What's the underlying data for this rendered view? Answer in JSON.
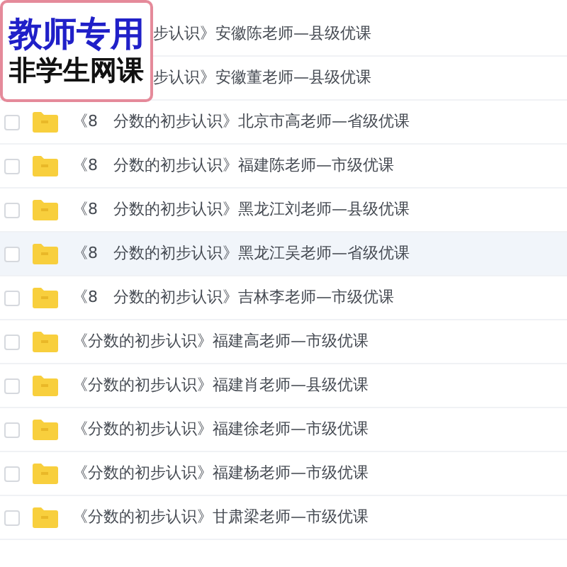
{
  "badge": {
    "lines": [
      "教师专用",
      "非学生网课"
    ]
  },
  "files": [
    {
      "name": "步认识》安徽陈老师—县级优课",
      "covered": true,
      "selected": false
    },
    {
      "name": "步认识》安徽董老师—县级优课",
      "covered": true,
      "selected": false
    },
    {
      "name": "《8　分数的初步认识》北京市高老师—省级优课",
      "checked": false,
      "selected": false
    },
    {
      "name": "《8　分数的初步认识》福建陈老师—市级优课",
      "checked": false,
      "selected": false
    },
    {
      "name": "《8　分数的初步认识》黑龙江刘老师—县级优课",
      "checked": false,
      "selected": false
    },
    {
      "name": "《8　分数的初步认识》黑龙江吴老师—省级优课",
      "checked": false,
      "selected": true
    },
    {
      "name": "《8　分数的初步认识》吉林李老师—市级优课",
      "checked": false,
      "selected": false
    },
    {
      "name": "《分数的初步认识》福建高老师—市级优课",
      "checked": false,
      "selected": false
    },
    {
      "name": "《分数的初步认识》福建肖老师—县级优课",
      "checked": false,
      "selected": false
    },
    {
      "name": "《分数的初步认识》福建徐老师—市级优课",
      "checked": false,
      "selected": false
    },
    {
      "name": "《分数的初步认识》福建杨老师—市级优课",
      "checked": false,
      "selected": false
    },
    {
      "name": "《分数的初步认识》甘肃梁老师—市级优课",
      "checked": false,
      "selected": false
    }
  ]
}
